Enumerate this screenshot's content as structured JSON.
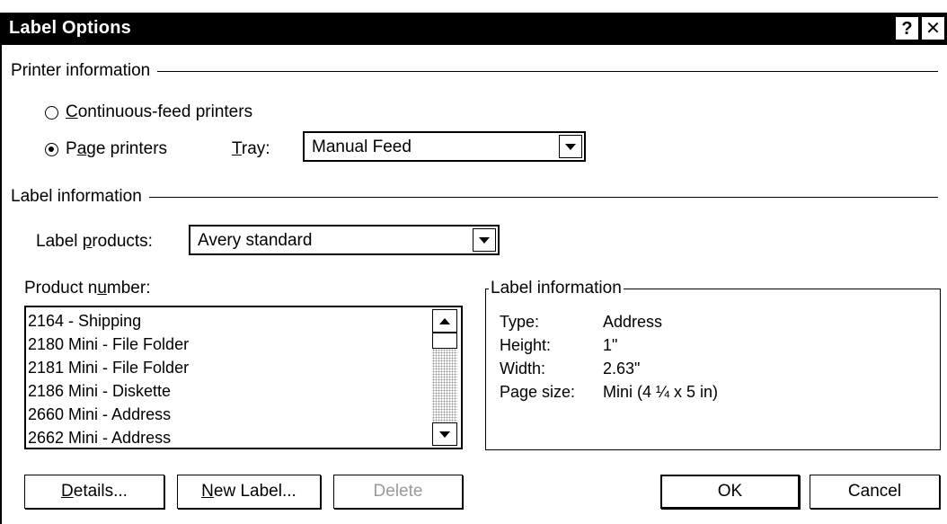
{
  "window": {
    "title": "Label Options",
    "help_glyph": "?",
    "close_glyph": "✕"
  },
  "printer_info": {
    "group_title": "Printer information",
    "continuous_label_prefix": "",
    "continuous_label_mnemonic": "C",
    "continuous_label_rest": "ontinuous-feed printers",
    "page_label_prefix": "P",
    "page_label_mnemonic": "a",
    "page_label_rest": "ge printers",
    "selected": "page",
    "tray_label_mnemonic": "T",
    "tray_label_rest": "ray:",
    "tray_value": "Manual Feed"
  },
  "label_info_group": {
    "group_title": "Label information",
    "products_label_prefix": "Label ",
    "products_label_mnemonic": "p",
    "products_label_rest": "roducts:",
    "products_value": "Avery standard"
  },
  "product_number": {
    "label_prefix": "Product n",
    "label_mnemonic": "u",
    "label_rest": "mber:",
    "items": [
      "2164 - Shipping",
      "2180 Mini - File Folder",
      "2181 Mini - File Folder",
      "2186 Mini - Diskette",
      "2660 Mini - Address",
      "2662 Mini - Address"
    ]
  },
  "label_information_box": {
    "legend": "Label information",
    "rows": [
      {
        "key": "Type:",
        "value": "Address"
      },
      {
        "key": "Height:",
        "value": "1\""
      },
      {
        "key": "Width:",
        "value": "2.63\""
      },
      {
        "key": "Page size:",
        "value": "Mini (4 ¼ x 5 in)"
      }
    ]
  },
  "buttons": {
    "details_mnemonic": "D",
    "details_rest": "etails...",
    "new_label_mnemonic": "N",
    "new_label_rest": "ew Label...",
    "delete": "Delete",
    "ok": "OK",
    "cancel": "Cancel"
  }
}
